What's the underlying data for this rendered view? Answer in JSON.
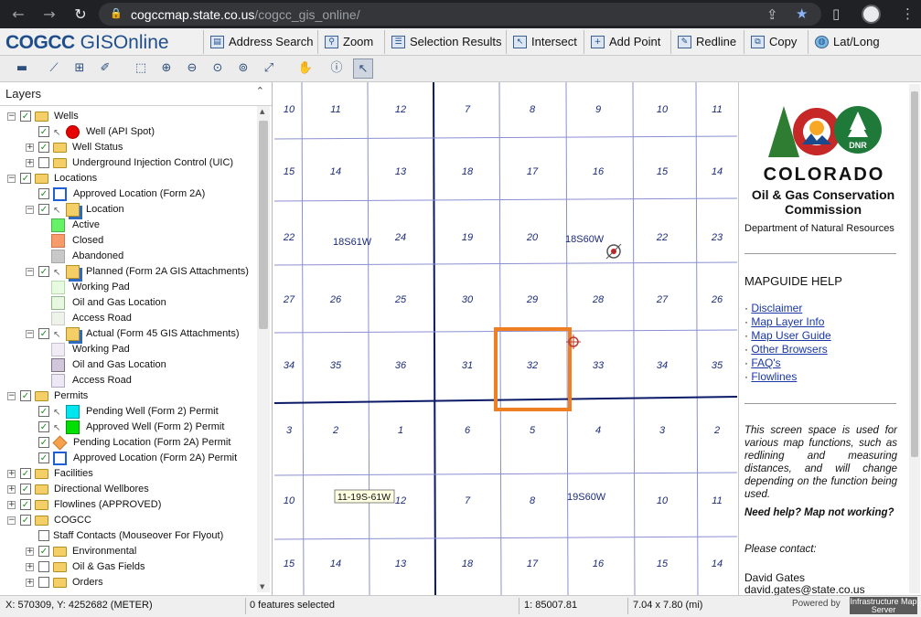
{
  "browser": {
    "url_host": "cogccmap.state.co.us",
    "url_path": "/cogcc_gis_online/",
    "back_icon": "arrow-left-icon",
    "forward_icon": "arrow-right-icon",
    "reload_icon": "reload-icon"
  },
  "app": {
    "logo_main": "COGCC",
    "logo_sub": "GISOnline"
  },
  "tools": [
    {
      "label": "Address Search",
      "icon": "address-search-icon"
    },
    {
      "label": "Zoom",
      "icon": "zoom-icon"
    },
    {
      "label": "Selection Results",
      "icon": "selection-results-icon"
    },
    {
      "label": "Intersect",
      "icon": "intersect-icon"
    },
    {
      "label": "Add Point",
      "icon": "add-point-icon"
    },
    {
      "label": "Redline",
      "icon": "redline-icon"
    },
    {
      "label": "Copy",
      "icon": "copy-icon"
    },
    {
      "label": "Lat/Long",
      "icon": "globe-icon"
    }
  ],
  "toolbar2": [
    "measure-icon",
    "buffer-icon",
    "select-icon",
    "edit-icon",
    "zoom-rect-icon",
    "zoom-in-icon",
    "zoom-out-icon",
    "zoom-prev-icon",
    "zoom-next-icon",
    "full-extent-icon",
    "pan-icon",
    "identify-icon",
    "pointer-icon"
  ],
  "layers": {
    "title": "Layers",
    "rows": [
      {
        "label": "Wells",
        "level": 0,
        "exp": "−",
        "checked": true,
        "folder": true
      },
      {
        "label": "Well (API Spot)",
        "level": 1,
        "checked": true,
        "arrow": true,
        "sym": "red-circle"
      },
      {
        "label": "Well Status",
        "level": 1,
        "exp": "+",
        "checked": true,
        "folder": true
      },
      {
        "label": "Underground Injection Control (UIC)",
        "level": 1,
        "exp": "+",
        "checked": false,
        "folder": true
      },
      {
        "label": "Locations",
        "level": 0,
        "exp": "−",
        "checked": true,
        "folder": true
      },
      {
        "label": "Approved Location (Form 2A)",
        "level": 1,
        "checked": true,
        "sym": "blue-square"
      },
      {
        "label": "Location",
        "level": 1,
        "exp": "−",
        "checked": true,
        "arrow": true,
        "sym": "stack"
      },
      {
        "label": "Active",
        "level": 2,
        "sym": "green-fill"
      },
      {
        "label": "Closed",
        "level": 2,
        "sym": "orange-fill"
      },
      {
        "label": "Abandoned",
        "level": 2,
        "sym": "gray-fill"
      },
      {
        "label": "Planned (Form 2A GIS Attachments)",
        "level": 1,
        "exp": "−",
        "checked": true,
        "arrow": true,
        "sym": "stack"
      },
      {
        "label": "Working Pad",
        "level": 2,
        "sym": "pale-green"
      },
      {
        "label": "Oil and Gas Location",
        "level": 2,
        "sym": "pale-green2"
      },
      {
        "label": "Access Road",
        "level": 2,
        "sym": "pale-gray"
      },
      {
        "label": "Actual (Form 45 GIS Attachments)",
        "level": 1,
        "exp": "−",
        "checked": true,
        "arrow": true,
        "sym": "stack"
      },
      {
        "label": "Working Pad",
        "level": 2,
        "sym": "pale-lav"
      },
      {
        "label": "Oil and Gas Location",
        "level": 2,
        "sym": "mid-lav"
      },
      {
        "label": "Access Road",
        "level": 2,
        "sym": "pale-lav2"
      },
      {
        "label": "Permits",
        "level": 0,
        "exp": "−",
        "checked": true,
        "folder": true
      },
      {
        "label": "Pending Well (Form 2) Permit",
        "level": 1,
        "checked": true,
        "arrow": true,
        "sym": "cyan-square"
      },
      {
        "label": "Approved Well (Form 2) Permit",
        "level": 1,
        "checked": true,
        "arrow": true,
        "sym": "green-square"
      },
      {
        "label": "Pending Location (Form 2A) Permit",
        "level": 1,
        "checked": true,
        "sym": "orange-diamond"
      },
      {
        "label": "Approved Location (Form 2A) Permit",
        "level": 1,
        "checked": true,
        "sym": "blue-square"
      },
      {
        "label": "Facilities",
        "level": 0,
        "exp": "+",
        "checked": true,
        "folder": true
      },
      {
        "label": "Directional Wellbores",
        "level": 0,
        "exp": "+",
        "checked": true,
        "folder": true
      },
      {
        "label": "Flowlines (APPROVED)",
        "level": 0,
        "exp": "+",
        "checked": true,
        "folder": true
      },
      {
        "label": "COGCC",
        "level": 0,
        "exp": "−",
        "checked": true,
        "folder": true
      },
      {
        "label": "Staff Contacts (Mouseover For Flyout)",
        "level": 1,
        "checked": false
      },
      {
        "label": "Environmental",
        "level": 1,
        "exp": "+",
        "checked": true,
        "folder": true
      },
      {
        "label": "Oil & Gas Fields",
        "level": 1,
        "exp": "+",
        "checked": false,
        "folder": true
      },
      {
        "label": "Orders",
        "level": 1,
        "exp": "+",
        "checked": false,
        "folder": true
      }
    ]
  },
  "map": {
    "grid": [
      [
        "10",
        "11",
        "12",
        "7",
        "8",
        "9",
        "10",
        "11"
      ],
      [
        "15",
        "14",
        "13",
        "18",
        "17",
        "16",
        "15",
        "14"
      ],
      [
        "22",
        "",
        "24",
        "19",
        "20",
        "",
        "22",
        "23"
      ],
      [
        "27",
        "26",
        "25",
        "30",
        "29",
        "28",
        "27",
        "26"
      ],
      [
        "34",
        "35",
        "36",
        "31",
        "32",
        "33",
        "34",
        "35"
      ],
      [
        "3",
        "2",
        "1",
        "6",
        "5",
        "4",
        "3",
        "2"
      ],
      [
        "10",
        "",
        "12",
        "7",
        "8",
        "",
        "10",
        "11"
      ],
      [
        "15",
        "14",
        "13",
        "18",
        "17",
        "16",
        "15",
        "14"
      ]
    ],
    "township_labels": [
      "18S61W",
      "18S60W",
      "19S60W"
    ],
    "tooltip": "11-19S-61W",
    "highlight_section": "32",
    "highlight_color": "#f07f24"
  },
  "help": {
    "state": "COLORADO",
    "commission": "Oil & Gas Conservation Commission",
    "dept": "Department of Natural Resources",
    "seal_text": "DNR",
    "title": "MAPGUIDE HELP",
    "links": [
      "Disclaimer",
      "Map Layer Info",
      "Map User Guide",
      "Other Browsers",
      "FAQ's",
      "Flowlines"
    ],
    "text": "This screen space is used for various map functions, such as redlining and measuring distances, and will change depending on the function being used.",
    "need": "Need help? Map not working?",
    "contact": "Please contact:",
    "name": "David Gates",
    "email": "david.gates@state.co.us"
  },
  "status": {
    "coords": "X: 570309, Y: 4252682 (METER)",
    "selected": "0 features selected",
    "scale": "1: 85007.81",
    "extent": "7.04 x 7.80 (mi)",
    "powered": "Powered by",
    "ims": "Infrastructure Map Server"
  }
}
